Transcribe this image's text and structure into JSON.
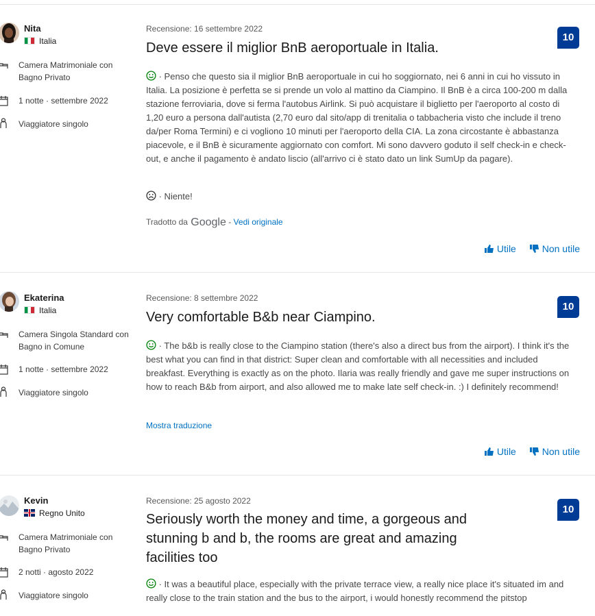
{
  "reviews": [
    {
      "user": {
        "name": "Nita",
        "country": "Italia"
      },
      "room": "Camera Matrimoniale con Bagno Privato",
      "stay_nights": "1 notte ·",
      "stay_date": "settembre 2022",
      "traveler": "Viaggiatore singolo",
      "date": "Recensione: 16 settembre 2022",
      "title": "Deve essere il miglior BnB aeroportuale in Italia.",
      "positive": " · Penso che questo sia il miglior BnB aeroportuale in cui ho soggiornato, nei 6 anni in cui ho vissuto in Italia. La posizione è perfetta se si prende un volo al mattino da Ciampino. Il BnB è a circa 100-200 m dalla stazione ferroviaria, dove si ferma l'autobus Airlink. Si può acquistare il biglietto per l'aeroporto al costo di 1,20 euro a persona dall'autista (2,70 euro dal sito/app di trenitalia o tabbacheria visto che include il treno da/per Roma Termini) e ci vogliono 10 minuti per l'aeroporto della CIA. La zona circostante è abbastanza piacevole, e il BnB è sicuramente aggiornato con comfort. Mi sono davvero goduto il self check-in e check-out, e anche il pagamento è andato liscio (all'arrivo ci è stato dato un link SumUp da pagare).",
      "negative": " · Niente!",
      "translated_by": "Tradotto da",
      "google": "Google",
      "sep": " - ",
      "original_link": "Vedi originale",
      "score": "10",
      "helpful": "Utile",
      "not_helpful": "Non utile"
    },
    {
      "user": {
        "name": "Ekaterina",
        "country": "Italia"
      },
      "room": "Camera Singola Standard con Bagno in Comune",
      "stay_nights": "1 notte ·",
      "stay_date": "settembre 2022",
      "traveler": "Viaggiatore singolo",
      "date": "Recensione: 8 settembre 2022",
      "title": "Very comfortable B&b near Ciampino.",
      "positive": " · The b&b is really close to the Ciampino station (there's also a direct bus from the airport). I think it's the best what you can find in that district: Super clean and comfortable with all necessities and included breakfast. Everything is exactly as on the photo. Ilaria was really friendly and gave me super instructions on how to reach B&b from airport, and also allowed me to make late self check-in. :) I definitely recommend!",
      "translate_link": "Mostra traduzione",
      "score": "10",
      "helpful": "Utile",
      "not_helpful": "Non utile"
    },
    {
      "user": {
        "name": "Kevin",
        "country": "Regno Unito"
      },
      "room": "Camera Matrimoniale con Bagno Privato",
      "stay_nights": "2 notti ·",
      "stay_date": "agosto 2022",
      "traveler": "Viaggiatore singolo",
      "date": "Recensione: 25 agosto 2022",
      "title": "Seriously worth the money and time, a gorgeous and stunning b and b, the rooms are great and amazing facilities too",
      "positive": " · It was a beautiful place, especially with the private terrace view, a really nice place it's situated im and really close to the train station and the bus to the airport, i would honestly recommend the pitstop",
      "score": "10"
    }
  ],
  "colors": {
    "accent": "#0071c2",
    "score_bg": "#003b95",
    "positive": "#008009"
  }
}
